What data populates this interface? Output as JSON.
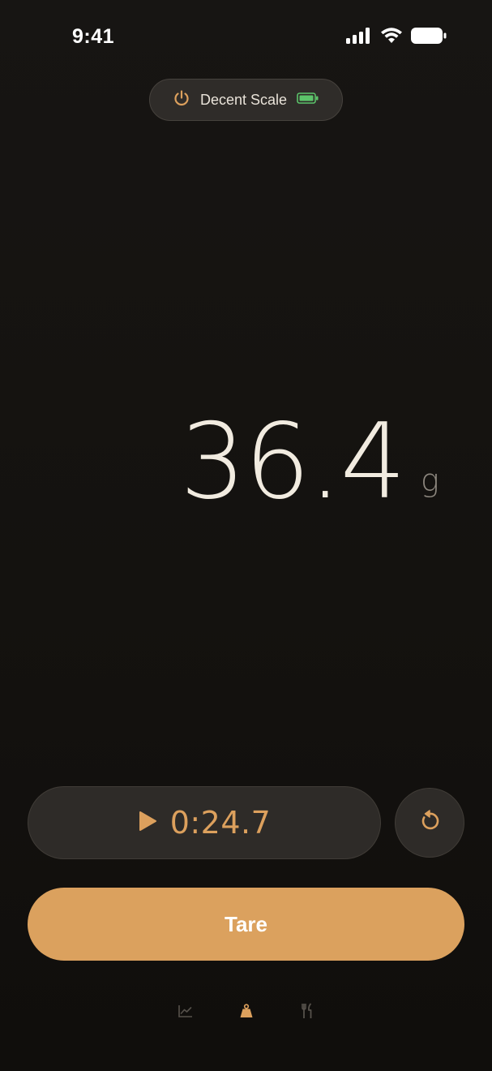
{
  "status_bar": {
    "time": "9:41",
    "icons": [
      "signal-icon",
      "wifi-icon",
      "battery-icon"
    ]
  },
  "device": {
    "name": "Decent Scale",
    "power_icon": "power-icon",
    "battery_icon": "battery-icon",
    "battery_level": 1.0,
    "battery_color": "#5cc46a"
  },
  "scale": {
    "weight": "36.4",
    "unit": "g"
  },
  "timer": {
    "value": "0:24.7",
    "play_icon": "play-icon",
    "reset_icon": "reset-icon"
  },
  "actions": {
    "tare_label": "Tare"
  },
  "tab_bar": {
    "tabs": [
      {
        "icon": "chart-icon",
        "active": false
      },
      {
        "icon": "scale-weight-icon",
        "active": true
      },
      {
        "icon": "utensils-icon",
        "active": false
      }
    ]
  },
  "colors": {
    "accent": "#dca05d",
    "background": "#15130f",
    "surface": "#2e2b28",
    "text_primary": "#f1ebe0",
    "text_secondary": "#8d877f"
  }
}
